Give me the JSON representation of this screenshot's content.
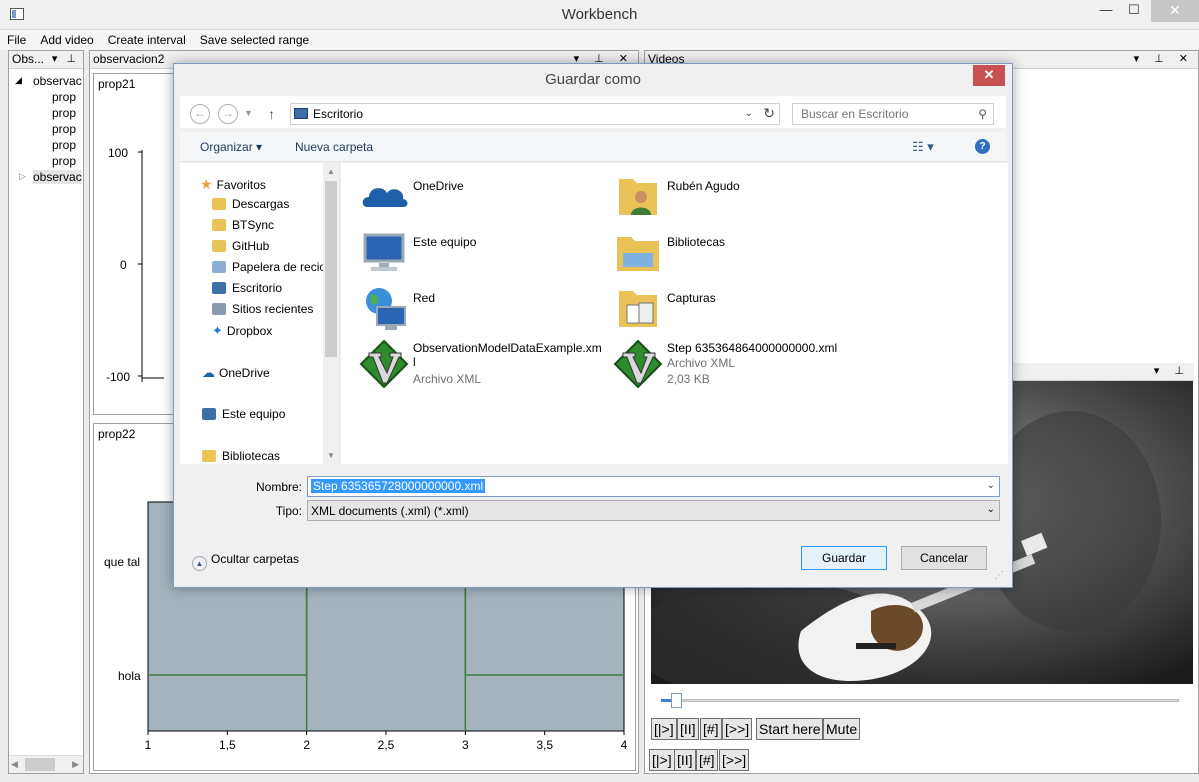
{
  "window": {
    "title": "Workbench",
    "min": "—",
    "max": "☐",
    "close": "✕"
  },
  "menu": [
    "File",
    "Add video",
    "Create interval",
    "Save selected range"
  ],
  "obs_panel": {
    "title": "Obs...",
    "controls": "▾ ⊥",
    "root1": "observac",
    "children": [
      "prop",
      "prop",
      "prop",
      "prop",
      "prop"
    ],
    "root2": "observac"
  },
  "obs_panel2": {
    "title": "observacion2",
    "controls": "▾ ⊥ ✕"
  },
  "chart1": {
    "title": "prop21",
    "y_ticks": [
      "100",
      "0",
      "-100"
    ]
  },
  "chart2": {
    "title": "prop22",
    "y_ticks": [
      "que tal",
      "hola"
    ],
    "x_ticks": [
      "1",
      "1,5",
      "2",
      "2,5",
      "3",
      "3,5",
      "4"
    ]
  },
  "chart_data": {
    "type": "line",
    "title": "prop22",
    "x": [
      1,
      2,
      2,
      3,
      3,
      4
    ],
    "y_categories": [
      "hola",
      "que tal"
    ],
    "y": [
      "hola",
      "hola",
      "que tal",
      "que tal",
      "hola",
      "hola"
    ],
    "xlim": [
      1,
      4
    ]
  },
  "videos_panel": {
    "title": "Videos",
    "controls": "▾ ⊥ ✕",
    "sub_controls": "▾ ⊥",
    "player_buttons": [
      "[|>]",
      "[II]",
      "[#]",
      "[>>]",
      "Start here",
      "Mute"
    ],
    "bottom_buttons": [
      "[|>]",
      "[II]",
      "[#]",
      "[>>]"
    ],
    "seek_position": 0.02
  },
  "dialog": {
    "title": "Guardar como",
    "close": "✕",
    "address": "Escritorio",
    "search_placeholder": "Buscar en Escritorio",
    "organize": "Organizar ▾",
    "new_folder": "Nueva carpeta",
    "nav": [
      {
        "label": "Favoritos",
        "icon": "star-icon",
        "color": "#e8a33c"
      },
      {
        "label": "Descargas",
        "icon": "downloads-folder-icon",
        "color": "#e9c258"
      },
      {
        "label": "BTSync",
        "icon": "folder-icon",
        "color": "#e9c258"
      },
      {
        "label": "GitHub",
        "icon": "folder-icon",
        "color": "#e9c258"
      },
      {
        "label": "Papelera de recic",
        "icon": "recycle-bin-icon",
        "color": "#8fb0d4"
      },
      {
        "label": "Escritorio",
        "icon": "desktop-icon",
        "color": "#3d6ea8"
      },
      {
        "label": "Sitios recientes",
        "icon": "recent-places-icon",
        "color": "#8a9bb0"
      },
      {
        "label": "Dropbox",
        "icon": "dropbox-icon",
        "color": "#1f7bd8"
      },
      {
        "label": "OneDrive",
        "icon": "cloud-icon",
        "color": "#1f5ea8"
      },
      {
        "label": "Este equipo",
        "icon": "computer-icon",
        "color": "#3d6ea8"
      },
      {
        "label": "Bibliotecas",
        "icon": "library-icon",
        "color": "#e9c258"
      }
    ],
    "items": [
      {
        "name": "OneDrive",
        "icon": "onedrive-icon",
        "meta1": "",
        "meta2": ""
      },
      {
        "name": "Rubén Agudo",
        "icon": "user-folder-icon",
        "meta1": "",
        "meta2": ""
      },
      {
        "name": "Este equipo",
        "icon": "computer-icon",
        "meta1": "",
        "meta2": ""
      },
      {
        "name": "Bibliotecas",
        "icon": "libraries-icon",
        "meta1": "",
        "meta2": ""
      },
      {
        "name": "Red",
        "icon": "network-icon",
        "meta1": "",
        "meta2": ""
      },
      {
        "name": "Capturas",
        "icon": "folder-icon",
        "meta1": "",
        "meta2": ""
      },
      {
        "name": "ObservationModelDataExample.xml",
        "icon": "vim-icon",
        "meta1": "Archivo XML",
        "meta2": ""
      },
      {
        "name": "Step 635364864000000000.xml",
        "icon": "vim-icon",
        "meta1": "Archivo XML",
        "meta2": "2,03 KB"
      }
    ],
    "filename_label": "Nombre:",
    "filename_value": "Step 635365728000000000.xml",
    "type_label": "Tipo:",
    "type_value": "XML documents (.xml) (*.xml)",
    "hide_folders": "Ocultar carpetas",
    "save": "Guardar",
    "cancel": "Cancelar"
  }
}
